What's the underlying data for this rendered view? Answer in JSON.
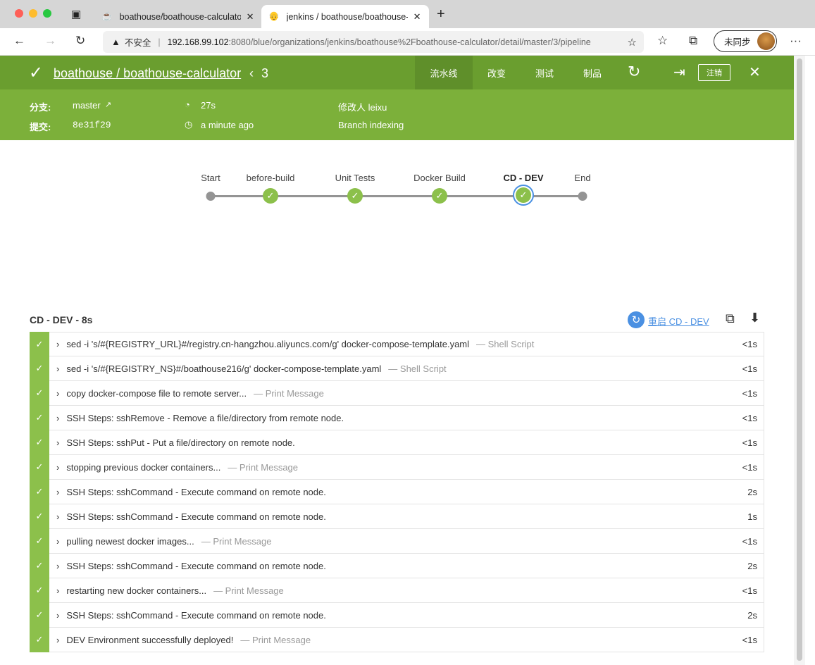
{
  "browser": {
    "tabs": [
      {
        "title": "boathouse/boathouse-calculator",
        "icon": "gitea-icon",
        "active": false
      },
      {
        "title": "jenkins / boathouse/boathouse-calculator",
        "icon": "jenkins-icon",
        "active": true
      }
    ],
    "security_label": "不安全",
    "url_host": "192.168.99.102",
    "url_rest": ":8080/blue/organizations/jenkins/boathouse%2Fboathouse-calculator/detail/master/3/pipeline",
    "sync_label": "未同步"
  },
  "header": {
    "title": "boathouse / boathouse-calculator",
    "run_number": "3",
    "nav": [
      "流水线",
      "改变",
      "测试",
      "制品"
    ],
    "active_nav": "流水线",
    "logout_label": "注销",
    "color": "#6a9e2f"
  },
  "summary": {
    "branch_label": "分支:",
    "branch": "master",
    "commit_label": "提交:",
    "commit": "8e31f29",
    "duration": "27s",
    "time": "a minute ago",
    "changes": "修改人 leixu",
    "cause": "Branch indexing"
  },
  "pipeline": {
    "stages": [
      {
        "name": "Start",
        "status": "none"
      },
      {
        "name": "before-build",
        "status": "success"
      },
      {
        "name": "Unit Tests",
        "status": "success"
      },
      {
        "name": "Docker Build",
        "status": "success"
      },
      {
        "name": "CD - DEV",
        "status": "success",
        "selected": true
      },
      {
        "name": "End",
        "status": "none"
      }
    ],
    "success_color": "#8cc04b"
  },
  "stage_detail": {
    "title": "CD - DEV - 8s",
    "restart_label": "重启 CD - DEV",
    "steps": [
      {
        "text": "sed -i 's/#{REGISTRY_URL}#/registry.cn-hangzhou.aliyuncs.com/g' docker-compose-template.yaml",
        "type": "— Shell Script",
        "duration": "<1s"
      },
      {
        "text": "sed -i 's/#{REGISTRY_NS}#/boathouse216/g' docker-compose-template.yaml",
        "type": "— Shell Script",
        "duration": "<1s"
      },
      {
        "text": "copy docker-compose file to remote server...",
        "type": "— Print Message",
        "duration": "<1s"
      },
      {
        "text": "SSH Steps: sshRemove - Remove a file/directory from remote node.",
        "type": "",
        "duration": "<1s"
      },
      {
        "text": "SSH Steps: sshPut - Put a file/directory on remote node.",
        "type": "",
        "duration": "<1s"
      },
      {
        "text": "stopping previous docker containers...",
        "type": "— Print Message",
        "duration": "<1s"
      },
      {
        "text": "SSH Steps: sshCommand - Execute command on remote node.",
        "type": "",
        "duration": "2s"
      },
      {
        "text": "SSH Steps: sshCommand - Execute command on remote node.",
        "type": "",
        "duration": "1s"
      },
      {
        "text": "pulling newest docker images...",
        "type": "— Print Message",
        "duration": "<1s"
      },
      {
        "text": "SSH Steps: sshCommand - Execute command on remote node.",
        "type": "",
        "duration": "2s"
      },
      {
        "text": "restarting new docker containers...",
        "type": "— Print Message",
        "duration": "<1s"
      },
      {
        "text": "SSH Steps: sshCommand - Execute command on remote node.",
        "type": "",
        "duration": "2s"
      },
      {
        "text": "DEV Environment successfully deployed!",
        "type": "— Print Message",
        "duration": "<1s"
      }
    ]
  }
}
